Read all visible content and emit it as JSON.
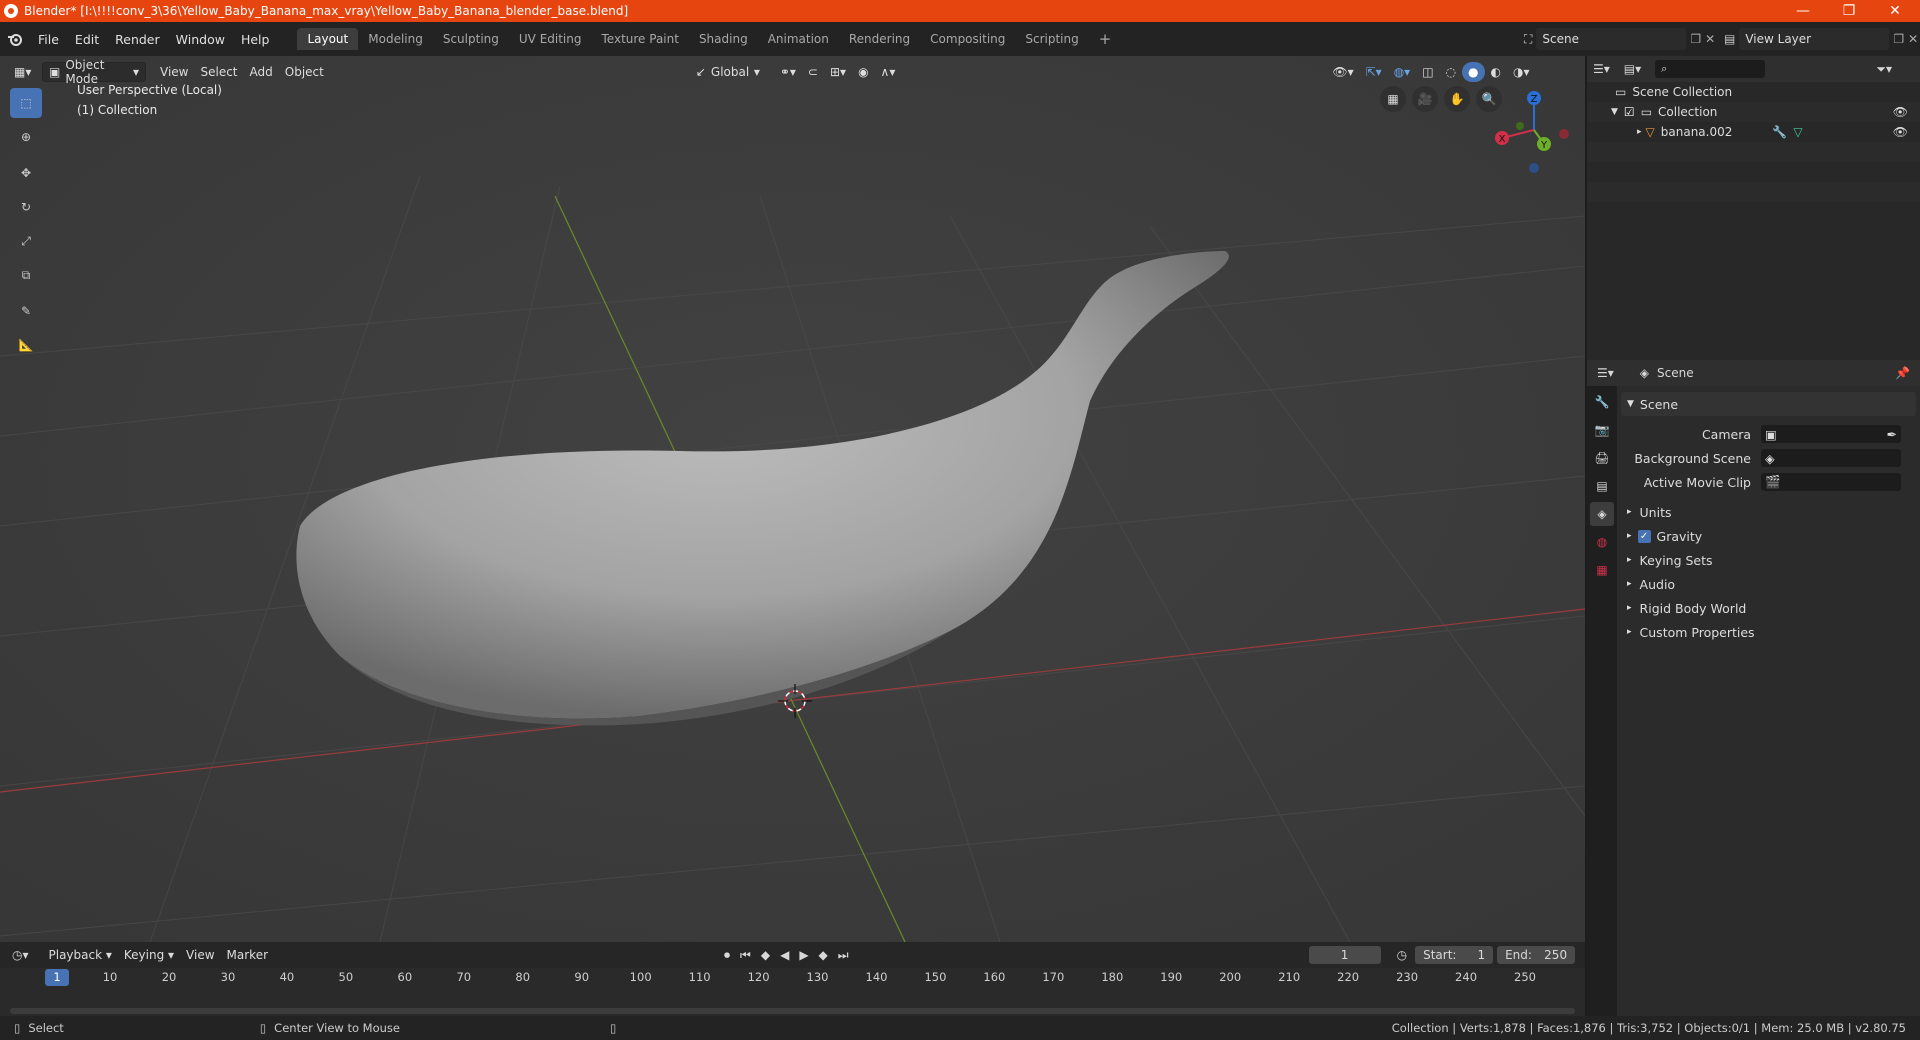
{
  "window": {
    "title": "Blender* [I:\\!!!!conv_3\\36\\Yellow_Baby_Banana_max_vray\\Yellow_Baby_Banana_blender_base.blend]",
    "controls": [
      "—",
      "❐",
      "✕"
    ]
  },
  "menubar": {
    "menus": [
      "File",
      "Edit",
      "Render",
      "Window",
      "Help"
    ],
    "workspaces": [
      "Layout",
      "Modeling",
      "Sculpting",
      "UV Editing",
      "Texture Paint",
      "Shading",
      "Animation",
      "Rendering",
      "Compositing",
      "Scripting"
    ],
    "active_workspace": "Layout",
    "add_workspace": "+",
    "scene_name": "Scene",
    "view_layer": "View Layer"
  },
  "viewport": {
    "mode": "Object Mode",
    "menus": [
      "View",
      "Select",
      "Add",
      "Object"
    ],
    "transform_orientation": "Global",
    "overlay_text_line1": "User Perspective (Local)",
    "overlay_text_line2": "(1) Collection",
    "gizmo": {
      "x": "X",
      "y": "Y",
      "z": "Z"
    }
  },
  "outliner": {
    "root": "Scene Collection",
    "collection": "Collection",
    "object": "banana.002"
  },
  "properties": {
    "header_title": "Scene",
    "section_title": "Scene",
    "camera_label": "Camera",
    "background_scene_label": "Background Scene",
    "active_movie_clip_label": "Active Movie Clip",
    "panels": [
      "Units",
      "Gravity",
      "Keying Sets",
      "Audio",
      "Rigid Body World",
      "Custom Properties"
    ],
    "gravity_checked": true
  },
  "timeline": {
    "menus": [
      "Playback",
      "Keying",
      "View",
      "Marker"
    ],
    "current_frame": "1",
    "start_label": "Start:",
    "start_value": "1",
    "end_label": "End:",
    "end_value": "250",
    "ruler_ticks": [
      "1",
      "10",
      "20",
      "30",
      "40",
      "50",
      "60",
      "70",
      "80",
      "90",
      "100",
      "110",
      "120",
      "130",
      "140",
      "150",
      "160",
      "170",
      "180",
      "190",
      "200",
      "210",
      "220",
      "230",
      "240",
      "250"
    ]
  },
  "statusbar": {
    "left_action": "Select",
    "middle_action": "Center View to Mouse",
    "stats": "Collection | Verts:1,878 | Faces:1,876 | Tris:3,752 | Objects:0/1 | Mem: 25.0 MB | v2.80.75"
  }
}
